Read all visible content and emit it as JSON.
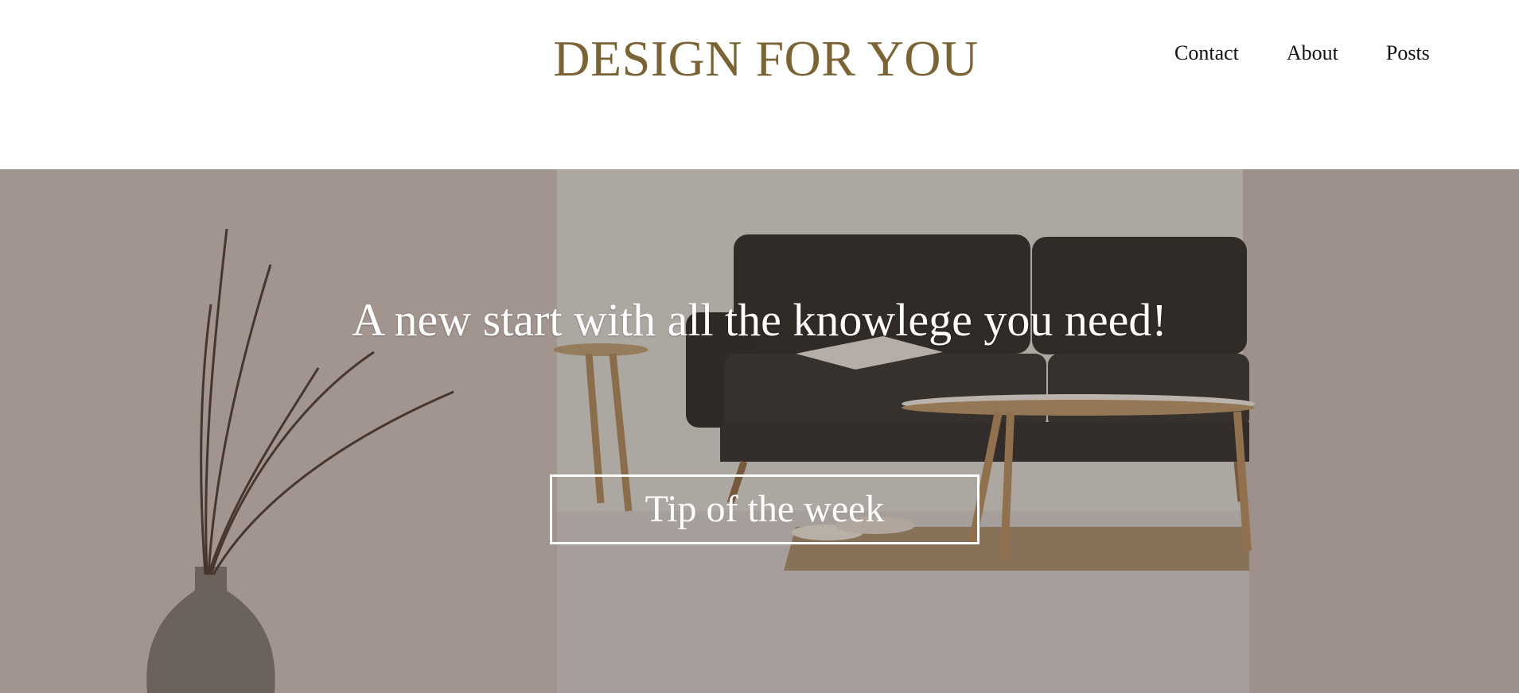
{
  "header": {
    "logo": "DESIGN FOR YOU",
    "nav": [
      {
        "label": "Contact"
      },
      {
        "label": "About"
      },
      {
        "label": "Posts"
      }
    ]
  },
  "hero": {
    "heading": "A new start with all the knowlege you need!",
    "button_label": "Tip of the week"
  },
  "colors": {
    "logo": "#7a6334",
    "nav_text": "#111111",
    "hero_text": "#ffffff"
  }
}
